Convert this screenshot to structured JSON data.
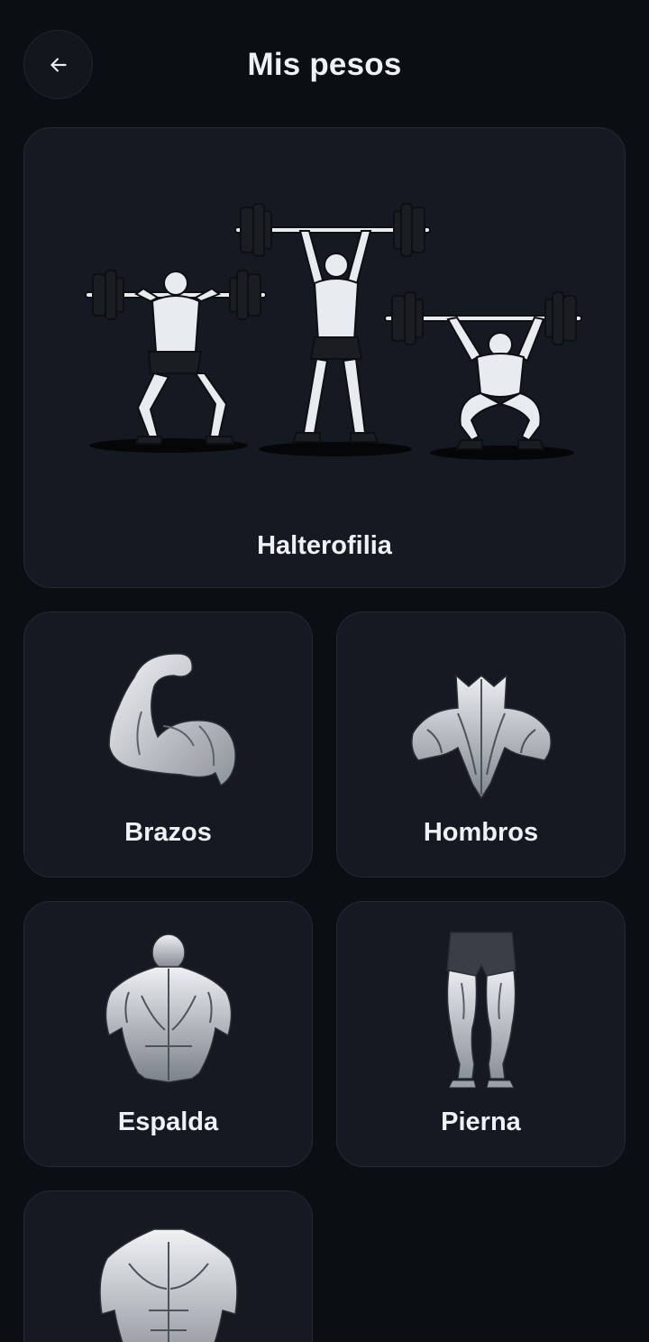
{
  "header": {
    "title": "Mis pesos",
    "back_icon": "arrow-left-icon"
  },
  "categories": [
    {
      "label": "Halterofilia",
      "icon": "weightlifting-illustration"
    },
    {
      "label": "Brazos",
      "icon": "flexed-arm-illustration"
    },
    {
      "label": "Hombros",
      "icon": "shoulders-illustration"
    },
    {
      "label": "Espalda",
      "icon": "back-muscles-illustration"
    },
    {
      "label": "Pierna",
      "icon": "legs-illustration"
    },
    {
      "label": "",
      "icon": "chest-torso-illustration"
    }
  ],
  "colors": {
    "background": "#0b0e13",
    "card": "#141922",
    "card_border": "#232a35",
    "text": "#eef1f5"
  }
}
